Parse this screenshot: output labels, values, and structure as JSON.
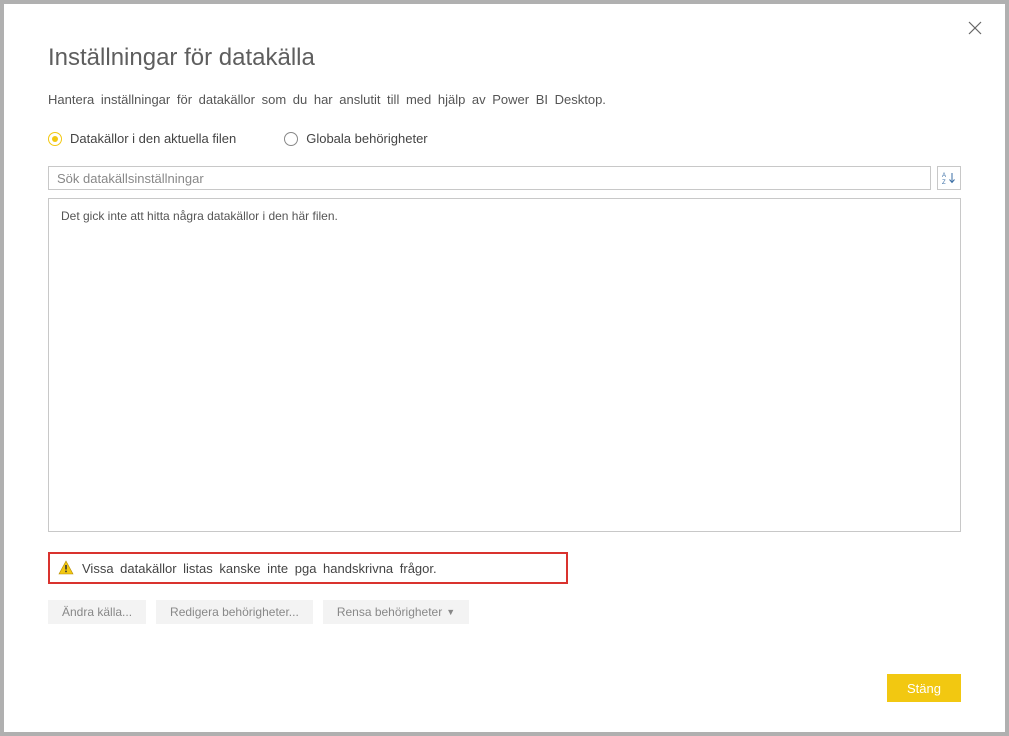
{
  "dialog": {
    "title": "Inställningar för datakälla",
    "subtitle": "Hantera inställningar för datakällor som du har anslutit till med hjälp av Power BI Desktop."
  },
  "radios": {
    "current_file": "Datakällor i den aktuella filen",
    "global_perms": "Globala behörigheter"
  },
  "search": {
    "placeholder": "Sök datakällsinställningar"
  },
  "list": {
    "empty_message": "Det gick inte att hitta några datakällor i den här filen."
  },
  "warning": {
    "text": "Vissa datakällor listas kanske inte pga handskrivna frågor."
  },
  "actions": {
    "change_source": "Ändra källa...",
    "edit_permissions": "Redigera behörigheter...",
    "clear_permissions": "Rensa behörigheter"
  },
  "footer": {
    "close": "Stäng"
  }
}
